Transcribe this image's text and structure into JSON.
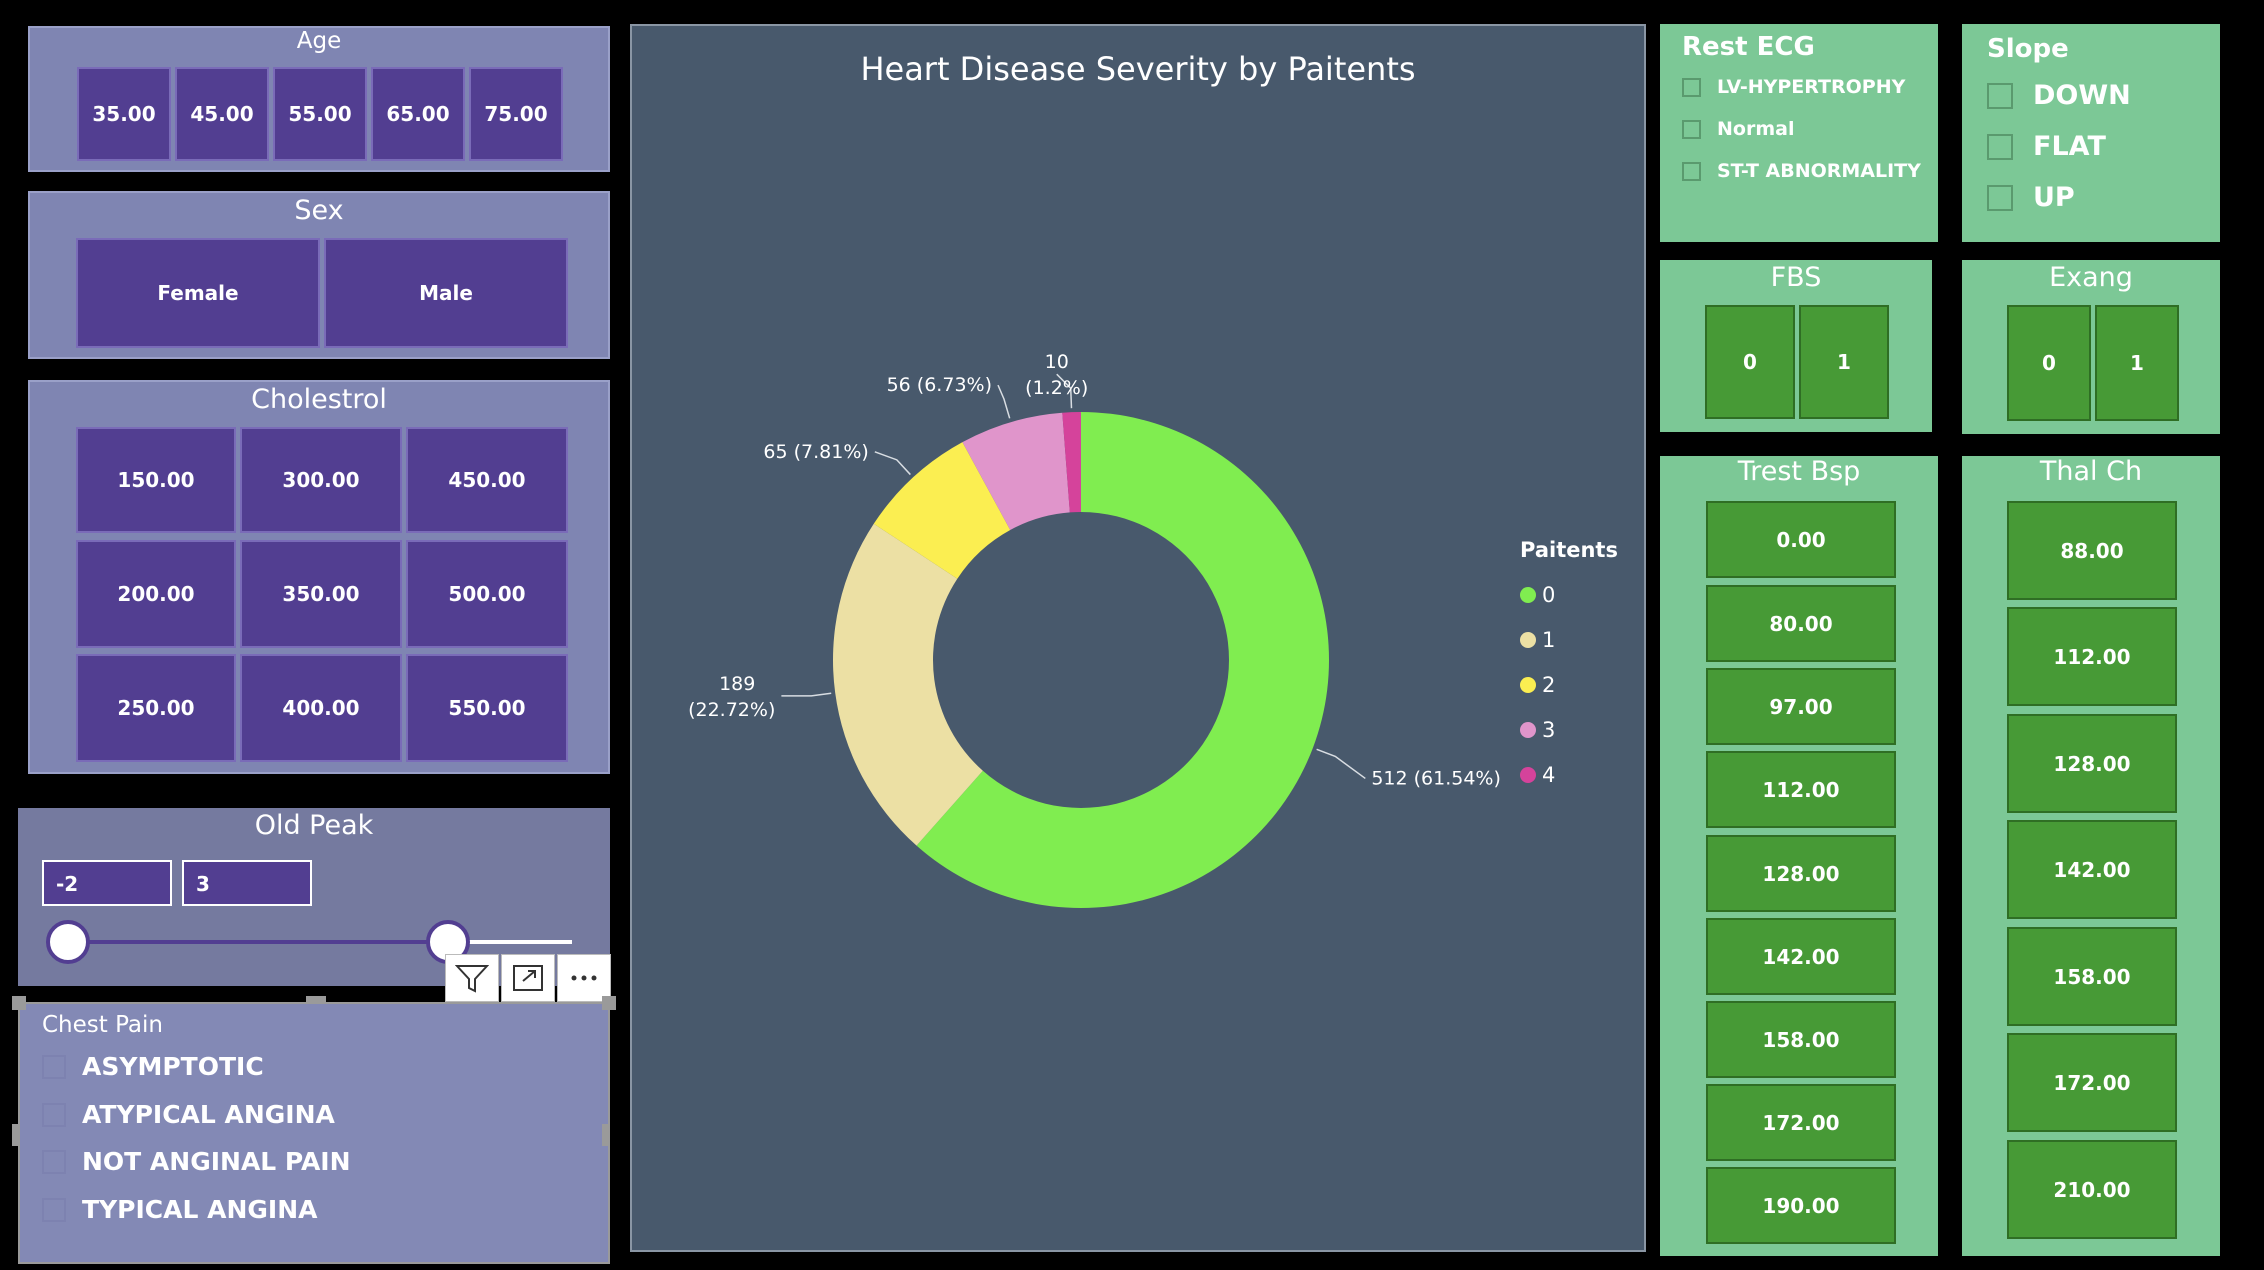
{
  "age": {
    "title": "Age",
    "values": [
      "35.00",
      "45.00",
      "55.00",
      "65.00",
      "75.00"
    ]
  },
  "sex": {
    "title": "Sex",
    "values": [
      "Female",
      "Male"
    ]
  },
  "cholestrol": {
    "title": "Cholestrol",
    "values": [
      "150.00",
      "300.00",
      "450.00",
      "200.00",
      "350.00",
      "500.00",
      "250.00",
      "400.00",
      "550.00"
    ]
  },
  "old_peak": {
    "title": "Old Peak",
    "min": "-2",
    "max": "3"
  },
  "chest_pain": {
    "title": "Chest Pain",
    "options": [
      "ASYMPTOTIC",
      "ATYPICAL ANGINA",
      "NOT ANGINAL PAIN",
      "TYPICAL ANGINA"
    ]
  },
  "rest_ecg": {
    "title": "Rest ECG",
    "options": [
      "LV-HYPERTROPHY",
      "Normal",
      "ST-T ABNORMALITY"
    ]
  },
  "slope": {
    "title": "Slope",
    "options": [
      "DOWN",
      "FLAT",
      "UP"
    ]
  },
  "fbs": {
    "title": "FBS",
    "values": [
      "0",
      "1"
    ]
  },
  "exang": {
    "title": "Exang",
    "values": [
      "0",
      "1"
    ]
  },
  "trest_bsp": {
    "title": "Trest Bsp",
    "values": [
      "0.00",
      "80.00",
      "97.00",
      "112.00",
      "128.00",
      "142.00",
      "158.00",
      "172.00",
      "190.00"
    ]
  },
  "thal_ch": {
    "title": "Thal Ch",
    "values": [
      "88.00",
      "112.00",
      "128.00",
      "142.00",
      "158.00",
      "172.00",
      "210.00"
    ]
  },
  "toolbar_icons": [
    "filter-icon",
    "focus-mode-icon",
    "more-options-icon"
  ],
  "chart_data": {
    "type": "pie",
    "donut": true,
    "title": "Heart Disease Severity by Paitents",
    "legend_title": "Paitents",
    "legend_position": "right",
    "categories": [
      "0",
      "1",
      "2",
      "3",
      "4"
    ],
    "values": [
      512,
      189,
      65,
      56,
      10
    ],
    "labels": [
      "512 (61.54%)",
      "189 (22.72%)",
      "65 (7.81%)",
      "56 (6.73%)",
      "10 (1.2%)"
    ],
    "colors": [
      "#80ed50",
      "#ece0a4",
      "#fbee51",
      "#e095cb",
      "#d5439b"
    ]
  }
}
